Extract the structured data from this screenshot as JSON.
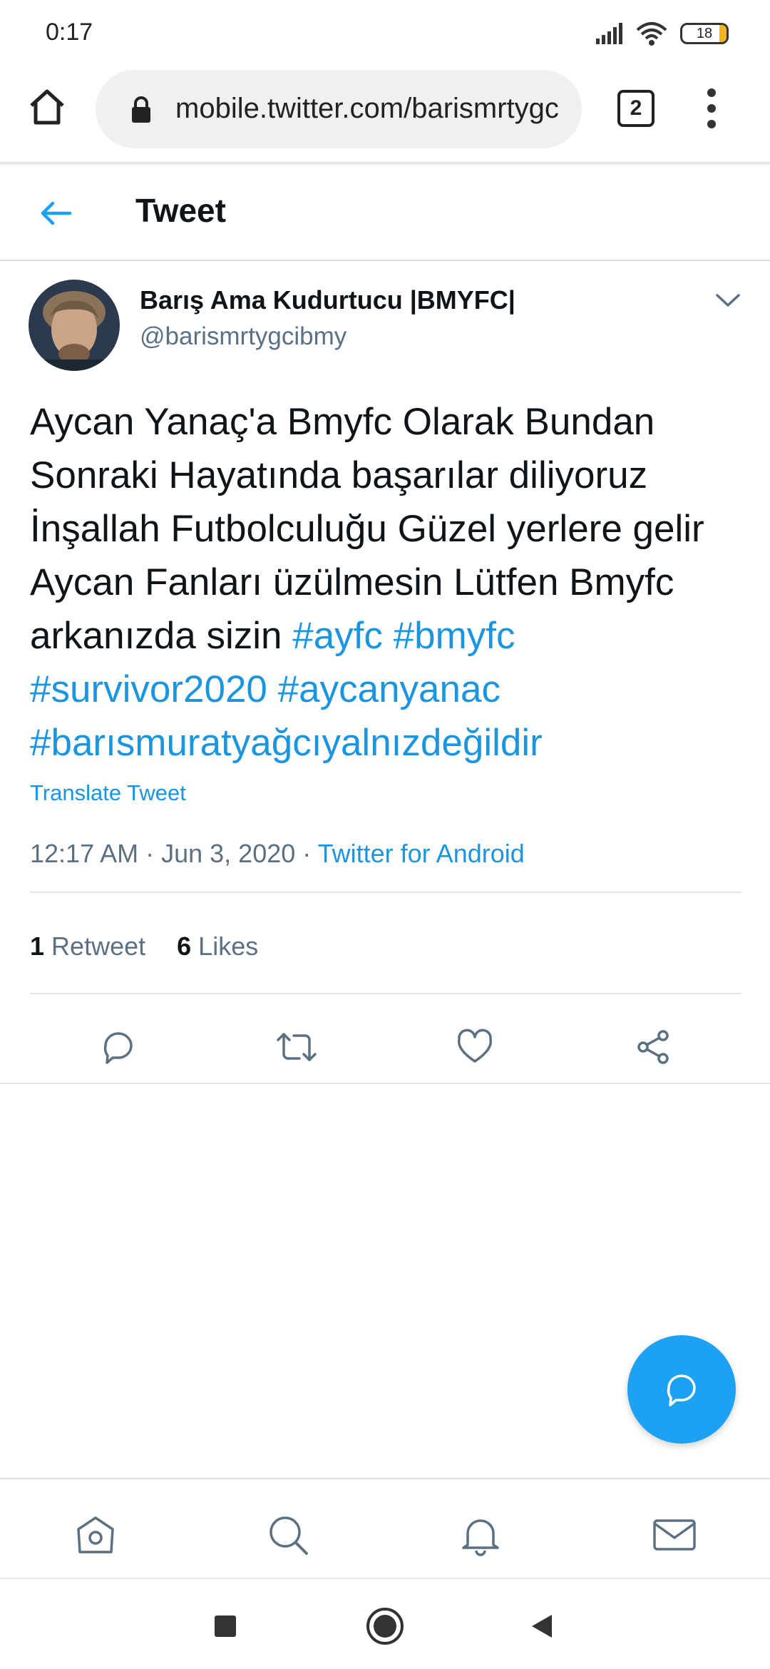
{
  "status_bar": {
    "time": "0:17",
    "battery": "18"
  },
  "browser": {
    "url": "mobile.twitter.com/barismrtygcibmy",
    "tab_count": "2"
  },
  "header": {
    "title": "Tweet"
  },
  "tweet": {
    "author_name": "Barış Ama Kudurtucu |BMYFC|",
    "author_handle": "@barismrtygcibmy",
    "text_plain": "Aycan Yanaç'a Bmyfc Olarak Bundan Sonraki Hayatında başarılar diliyoruz İnşallah Futbolculuğu Güzel yerlere gelir Aycan Fanları üzülmesin Lütfen Bmyfc arkanızda sizin ",
    "hashtags": [
      "#ayfc",
      "#bmyfc",
      "#survivor2020",
      "#aycanyanac",
      "#barısmuratyağcıyalnızdeğildir"
    ],
    "translate_label": "Translate Tweet",
    "timestamp": "12:17 AM · Jun 3, 2020",
    "separator": "·",
    "source": "Twitter for Android",
    "retweet_count": "1",
    "retweet_label": "Retweet",
    "like_count": "6",
    "like_label": "Likes"
  },
  "colors": {
    "twitter_blue": "#1da1f2",
    "link_blue": "#1b95e0",
    "secondary_text": "#5b7083"
  },
  "icons": {
    "browser": [
      "home-icon",
      "lock-icon",
      "tabs-icon",
      "more-vertical-icon"
    ],
    "actions": [
      "reply-icon",
      "retweet-icon",
      "like-icon",
      "share-icon"
    ],
    "bottom_nav": [
      "home-icon",
      "search-icon",
      "notifications-icon",
      "messages-icon"
    ],
    "system_nav": [
      "recents-icon",
      "home-circle-icon",
      "back-triangle-icon"
    ]
  }
}
